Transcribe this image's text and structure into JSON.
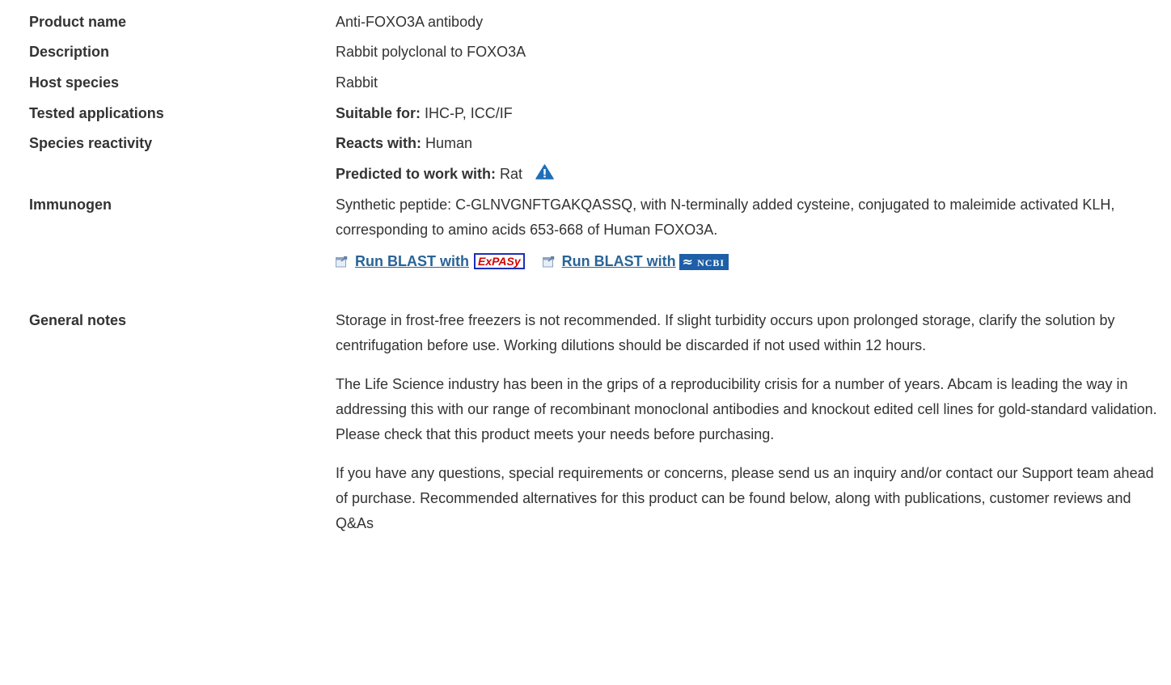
{
  "rows": {
    "product_name": {
      "label": "Product name",
      "value": "Anti-FOXO3A antibody"
    },
    "description": {
      "label": "Description",
      "value": "Rabbit polyclonal to FOXO3A"
    },
    "host_species": {
      "label": "Host species",
      "value": "Rabbit"
    },
    "tested_applications": {
      "label": "Tested applications",
      "prefix": "Suitable for:",
      "value": " IHC-P, ICC/IF"
    },
    "species_reactivity": {
      "label": "Species reactivity",
      "reacts_prefix": "Reacts with:",
      "reacts_value": " Human",
      "predicted_prefix": "Predicted to work with:",
      "predicted_value": " Rat"
    },
    "immunogen": {
      "label": "Immunogen",
      "value": "Synthetic peptide: C-GLNVGNFTGAKQASSQ, with N-terminally added cysteine, conjugated to maleimide activated KLH, corresponding to amino acids 653-668 of Human FOXO3A.",
      "blast_expasy_label": "Run BLAST with",
      "expasy_logo_text": "ExPASy",
      "blast_ncbi_label": "Run BLAST with",
      "ncbi_logo_text": "NCBI"
    },
    "general_notes": {
      "label": "General notes",
      "paragraphs": [
        "Storage in frost-free freezers is not recommended. If slight turbidity occurs upon prolonged storage, clarify the solution by centrifugation before use. Working dilutions should be discarded if not used within 12 hours.",
        "The Life Science industry has been in the grips of a reproducibility crisis for a number of years. Abcam is leading the way in addressing this with our range of recombinant monoclonal antibodies and knockout edited cell lines for gold-standard validation. Please check that this product meets your needs before purchasing.",
        "If you have any questions, special requirements or concerns, please send us an inquiry and/or contact our Support team ahead of purchase. Recommended alternatives for this product can be found below, along with publications, customer reviews and Q&As"
      ]
    }
  },
  "icons": {
    "prediction_warning": "warning-triangle-icon",
    "external_link": "external-link-icon"
  },
  "colors": {
    "text": "#333333",
    "link": "#2a6496",
    "warning_icon": "#1e6fb8",
    "expasy_red": "#d60000",
    "expasy_border": "#1b2fb8",
    "ncbi_blue": "#1e5fa8"
  }
}
